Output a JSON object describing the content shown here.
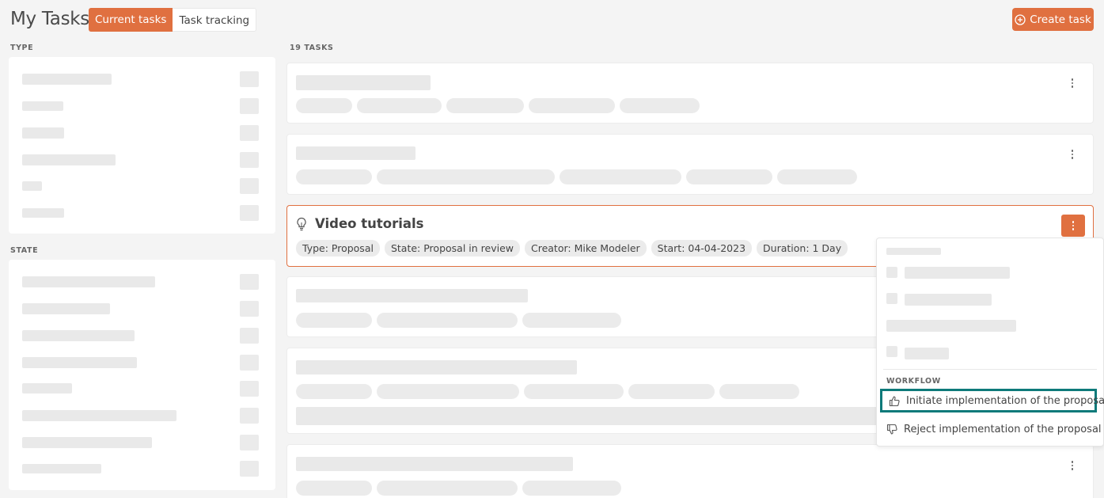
{
  "header": {
    "title": "My Tasks",
    "tabs": [
      {
        "label": "Current tasks",
        "active": true
      },
      {
        "label": "Task tracking",
        "active": false
      }
    ],
    "create_button": "Create task"
  },
  "filters": {
    "type_label": "TYPE",
    "state_label": "STATE"
  },
  "tasks": {
    "count_label": "19 TASKS",
    "selected": {
      "title": "Video tutorials",
      "icon": "lightbulb-icon",
      "tags": [
        "Type: Proposal",
        "State: Proposal in review",
        "Creator: Mike Modeler",
        "Start: 04-04-2023",
        "Duration: 1 Day"
      ]
    }
  },
  "context_menu": {
    "section_label": "WORKFLOW",
    "items": [
      {
        "label": "Initiate implementation of the proposal",
        "icon": "thumbs-up-icon",
        "highlighted": true
      },
      {
        "label": "Reject implementation of the proposal",
        "icon": "thumbs-down-icon",
        "highlighted": false
      }
    ]
  },
  "colors": {
    "accent": "#e07040",
    "highlight_border": "#0e7a7a",
    "background": "#f4f4f4"
  }
}
